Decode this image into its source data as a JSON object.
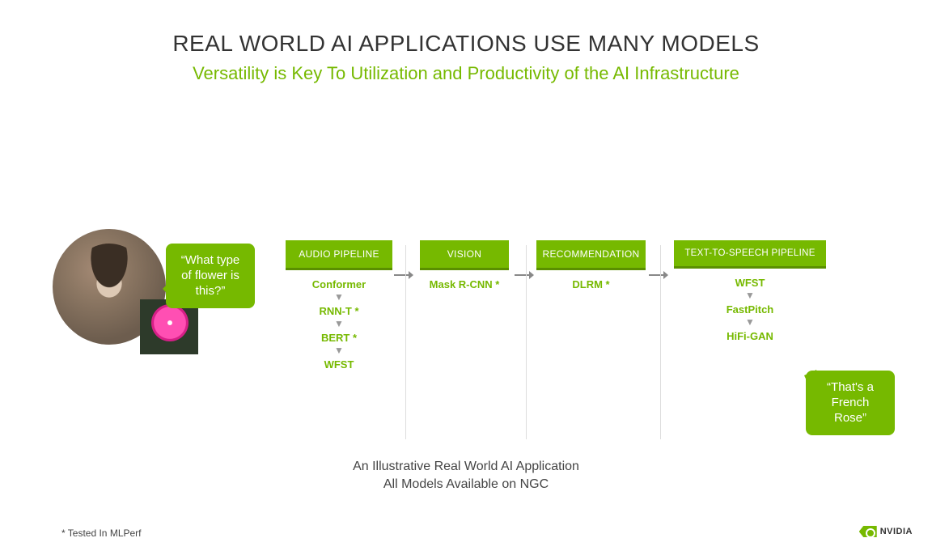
{
  "title": "REAL WORLD AI APPLICATIONS USE MANY MODELS",
  "subtitle": "Versatility is Key To Utilization and Productivity of the AI Infrastructure",
  "input_bubble": "“What type of flower is this?”",
  "output_bubble": "“That's a French Rose”",
  "pipelines": [
    {
      "header": "AUDIO PIPELINE",
      "models": [
        "Conformer",
        "RNN-T *",
        "BERT *",
        "WFST"
      ]
    },
    {
      "header": "VISION",
      "models": [
        "Mask R-CNN *"
      ]
    },
    {
      "header": "RECOMMENDATION",
      "models": [
        "DLRM *"
      ]
    },
    {
      "header": "TEXT-TO-SPEECH PIPELINE",
      "models": [
        "WFST",
        "FastPitch",
        "HiFi-GAN"
      ]
    }
  ],
  "caption_line1": "An Illustrative Real World AI Application",
  "caption_line2": "All Models Available on NGC",
  "footnote": "* Tested In MLPerf",
  "logo_text": "NVIDIA"
}
